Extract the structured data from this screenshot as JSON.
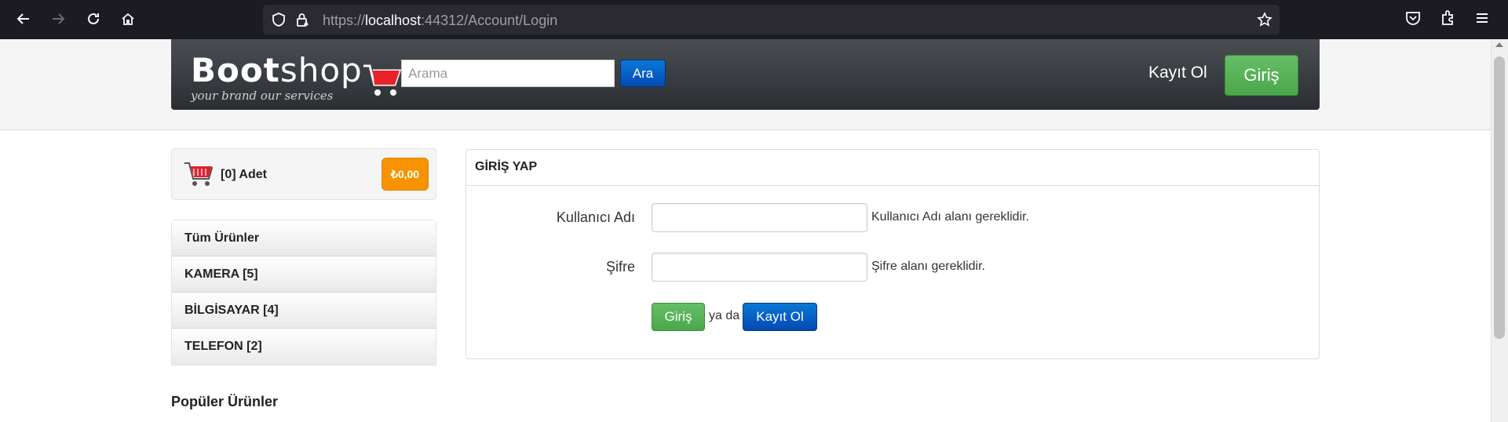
{
  "browser": {
    "url_prefix": "https://",
    "url_host": "localhost",
    "url_rest": ":44312/Account/Login"
  },
  "header": {
    "logo_bold": "Boot",
    "logo_light": "shop",
    "logo_tagline": "your brand our services",
    "search_placeholder": "Arama",
    "search_button": "Ara",
    "register_link": "Kayıt Ol",
    "login_button": "Giriş"
  },
  "cart": {
    "count_label": "[0] Adet",
    "total": "₺0,00"
  },
  "categories": [
    {
      "label": "Tüm Ürünler"
    },
    {
      "label": "KAMERA [5]"
    },
    {
      "label": "BİLGİSAYAR [4]"
    },
    {
      "label": "TELEFON [2]"
    }
  ],
  "sidebar": {
    "popular_title": "Popüler Ürünler"
  },
  "login_form": {
    "title": "GİRİŞ YAP",
    "username_label": "Kullanıcı Adı",
    "username_value": "",
    "username_help": "Kullanıcı Adı alanı gereklidir.",
    "password_label": "Şifre",
    "password_value": "",
    "password_help": "Şifre alanı gereklidir.",
    "submit_button": "Giriş",
    "or_text": "ya da",
    "register_button": "Kayıt Ol"
  },
  "colors": {
    "primary_blue": "#0449b3",
    "success_green": "#5cb85c",
    "warning_orange": "#f79300",
    "navbar_dark": "#2b2f33"
  }
}
